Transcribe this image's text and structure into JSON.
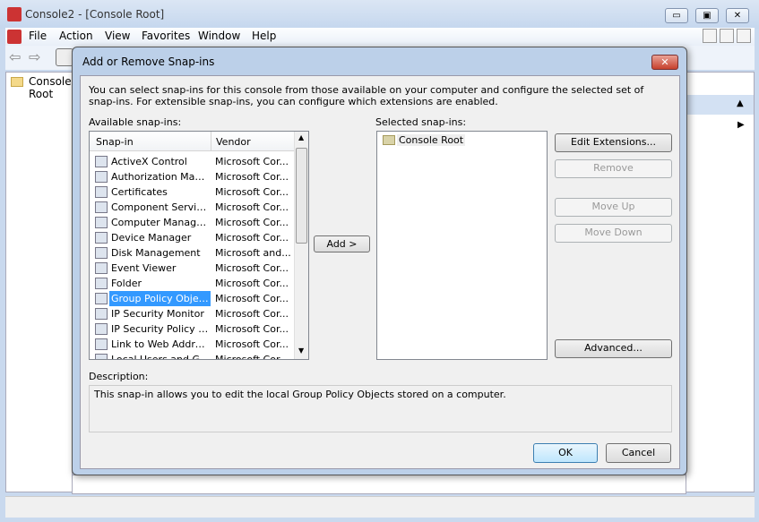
{
  "window": {
    "title": "Console2 - [Console Root]",
    "minimize": "▭",
    "maximize": "▣",
    "close": "✕"
  },
  "menu": [
    "File",
    "Action",
    "View",
    "Favorites",
    "Window",
    "Help"
  ],
  "tree": {
    "root": "Console Root"
  },
  "dialog": {
    "title": "Add or Remove Snap-ins",
    "close": "✕",
    "intro": "You can select snap-ins for this console from those available on your computer and configure the selected set of snap-ins. For extensible snap-ins, you can configure which extensions are enabled.",
    "available_label": "Available snap-ins:",
    "columns": [
      "Snap-in",
      "Vendor"
    ],
    "snapins": [
      {
        "name": "ActiveX Control",
        "vendor": "Microsoft Cor..."
      },
      {
        "name": "Authorization Manager",
        "vendor": "Microsoft Cor..."
      },
      {
        "name": "Certificates",
        "vendor": "Microsoft Cor..."
      },
      {
        "name": "Component Services",
        "vendor": "Microsoft Cor..."
      },
      {
        "name": "Computer Managem...",
        "vendor": "Microsoft Cor..."
      },
      {
        "name": "Device Manager",
        "vendor": "Microsoft Cor..."
      },
      {
        "name": "Disk Management",
        "vendor": "Microsoft and..."
      },
      {
        "name": "Event Viewer",
        "vendor": "Microsoft Cor..."
      },
      {
        "name": "Folder",
        "vendor": "Microsoft Cor..."
      },
      {
        "name": "Group Policy Object ...",
        "vendor": "Microsoft Cor...",
        "selected": true
      },
      {
        "name": "IP Security Monitor",
        "vendor": "Microsoft Cor..."
      },
      {
        "name": "IP Security Policy M...",
        "vendor": "Microsoft Cor..."
      },
      {
        "name": "Link to Web Address",
        "vendor": "Microsoft Cor..."
      },
      {
        "name": "Local Users and Gro...",
        "vendor": "Microsoft Cor..."
      }
    ],
    "add_button": "Add >",
    "selected_label": "Selected snap-ins:",
    "selected": [
      "Console Root"
    ],
    "buttons": {
      "edit_extensions": "Edit Extensions...",
      "remove": "Remove",
      "move_up": "Move Up",
      "move_down": "Move Down",
      "advanced": "Advanced..."
    },
    "description_label": "Description:",
    "description": "This snap-in allows you to edit the local Group Policy Objects stored on a computer.",
    "ok": "OK",
    "cancel": "Cancel"
  }
}
